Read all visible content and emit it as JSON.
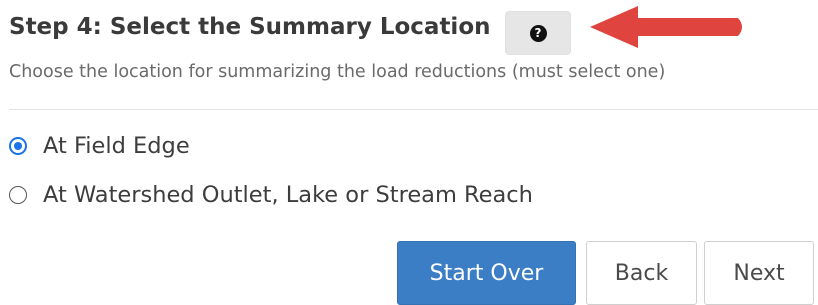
{
  "step": {
    "title": "Step 4: Select the Summary Location",
    "subtitle": "Choose the location for summarizing the load reductions (must select one)",
    "help_icon": "help-question-icon"
  },
  "annotation": {
    "arrow_icon": "red-pointer-arrow-icon",
    "arrow_color": "#e0443f"
  },
  "options": [
    {
      "label": "At Field Edge",
      "checked": true
    },
    {
      "label": "At Watershed Outlet, Lake or Stream Reach",
      "checked": false
    }
  ],
  "buttons": {
    "start_over": "Start Over",
    "back": "Back",
    "next": "Next"
  },
  "colors": {
    "accent": "#1a73e8",
    "primary_button": "#3b7ec6"
  }
}
